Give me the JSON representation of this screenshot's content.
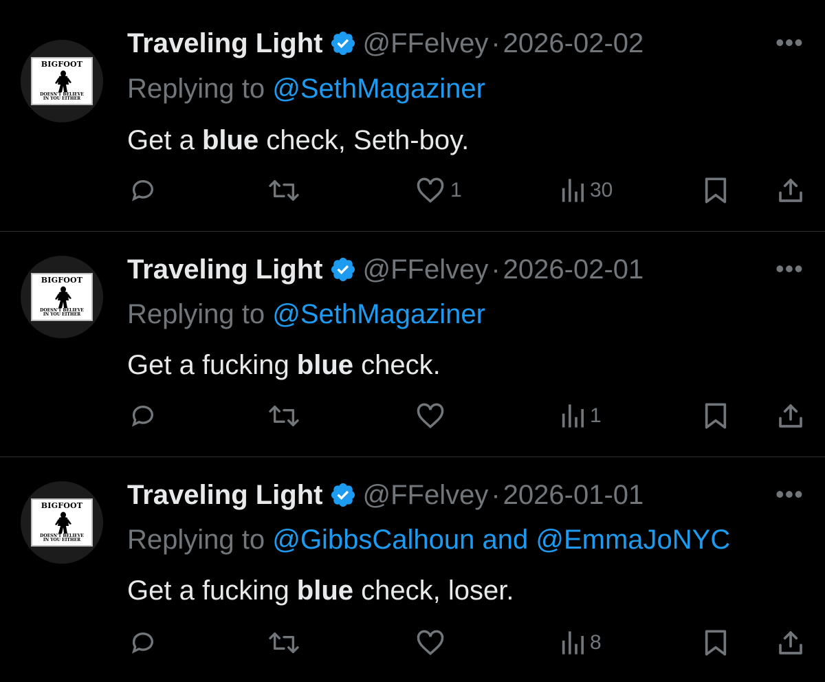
{
  "account": {
    "display_name": "Traveling Light",
    "handle": "@FFelvey",
    "avatar_top_text": "BIGFOOT",
    "avatar_bottom_text_1": "DOESN'T BELIEVE",
    "avatar_bottom_text_2": "IN YOU EITHER"
  },
  "separator": "·",
  "replying_prefix": "Replying to",
  "tweets": [
    {
      "date": "2026-02-02",
      "replying_to_1": "@SethMagaziner",
      "replying_to_2": "",
      "text_before": "Get a ",
      "text_bold": "blue",
      "text_after": " check, Seth-boy.",
      "likes": "1",
      "views": "30"
    },
    {
      "date": "2026-02-01",
      "replying_to_1": "@SethMagaziner",
      "replying_to_2": "",
      "text_before": "Get a fucking ",
      "text_bold": "blue",
      "text_after": " check.",
      "likes": "",
      "views": "1"
    },
    {
      "date": "2026-01-01",
      "replying_to_1": "@GibbsCalhoun",
      "replying_to_and": "and",
      "replying_to_2": "@EmmaJoNYC",
      "text_before": "Get a fucking ",
      "text_bold": "blue",
      "text_after": " check, loser.",
      "likes": "",
      "views": "8"
    }
  ],
  "colors": {
    "background": "#000000",
    "text": "#e7e9ea",
    "secondary": "#71767b",
    "link": "#1d9bf0",
    "verified": "#1d9bf0"
  }
}
